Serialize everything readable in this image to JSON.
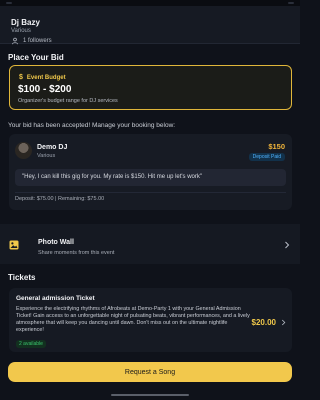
{
  "host": {
    "name": "Dj Bazy",
    "subtitle": "Various",
    "followers": "1 followers"
  },
  "bid_section": {
    "title": "Place Your Bid",
    "budget_label": "Event Budget",
    "budget_range": "$100 - $200",
    "budget_note": "Organizer's budget range for DJ services"
  },
  "accepted_text": "Your bid has been accepted! Manage your booking below:",
  "bid": {
    "dj_name": "Demo DJ",
    "dj_subtitle": "Various",
    "price": "$150",
    "status": "Deposit Paid",
    "message": "\"Hey, I can kill this gig for you. My rate is $150. Hit me up let's work\"",
    "deposit_line": "Deposit: $75.00 | Remaining: $75.00"
  },
  "photo_wall": {
    "title": "Photo Wall",
    "subtitle": "Share moments from this event"
  },
  "tickets": {
    "title": "Tickets",
    "items": [
      {
        "name": "General admission Ticket",
        "description": "Experience the electrifying rhythms of Afrobeats at Demo-Party 1 with your General Admission Ticket! Gain access to an unforgettable night of pulsating beats, vibrant performances, and a lively atmosphere that will keep you dancing until dawn. Don't miss out on the ultimate nightlife experience!",
        "price": "$20.00",
        "availability": "2 available"
      }
    ]
  },
  "request_button": "Request a Song",
  "colors": {
    "accent": "#f2c84c",
    "background": "#0f121a",
    "deposit_badge": "#4fb3ff",
    "available": "#3ac46b"
  }
}
